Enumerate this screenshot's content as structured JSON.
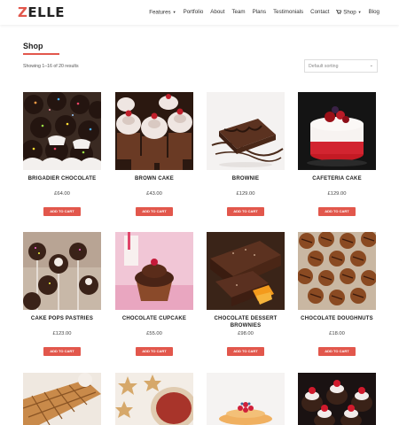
{
  "brand": {
    "name_rest": "ELLE",
    "name_first": "Z"
  },
  "nav": {
    "features": "Features",
    "portfolio": "Portfolio",
    "about": "About",
    "team": "Team",
    "plans": "Plans",
    "testimonials": "Testimonials",
    "contact": "Contact",
    "shop": "Shop",
    "blog": "Blog"
  },
  "page": {
    "title": "Shop",
    "results_text": "Showing 1–16 of 20 results",
    "sort_value": "Default sorting"
  },
  "colors": {
    "accent": "#e2574c"
  },
  "products": [
    {
      "name": "BRIGADIER CHOCOLATE",
      "price": "£64.00",
      "button": "ADD TO CART",
      "image": "brigadeiro-photo"
    },
    {
      "name": "BROWN CAKE",
      "price": "£43.00",
      "button": "ADD TO CART",
      "image": "cupcakes-photo"
    },
    {
      "name": "BROWNIE",
      "price": "£129.00",
      "button": "ADD TO CART",
      "image": "brownie-photo"
    },
    {
      "name": "CAFETERIA CAKE",
      "price": "£129.00",
      "button": "ADD TO CART",
      "image": "red-cake-photo"
    },
    {
      "name": "CAKE POPS PASTRIES",
      "price": "£123.00",
      "button": "ADD TO CART",
      "image": "cake-pops-photo"
    },
    {
      "name": "CHOCOLATE CUPCAKE",
      "price": "£55.00",
      "button": "ADD TO CART",
      "image": "cupcake-milk-photo"
    },
    {
      "name": "CHOCOLATE DESSERT BROWNIES",
      "price": "£98.00",
      "button": "ADD TO CART",
      "image": "dessert-brownies-photo"
    },
    {
      "name": "CHOCOLATE DOUGHNUTS",
      "price": "£18.00",
      "button": "ADD TO CART",
      "image": "doughnuts-photo"
    },
    {
      "name": "",
      "price": "",
      "button": "",
      "image": "waffles-photo"
    },
    {
      "name": "",
      "price": "",
      "button": "",
      "image": "star-cookies-photo"
    },
    {
      "name": "",
      "price": "",
      "button": "",
      "image": "pancakes-photo"
    },
    {
      "name": "",
      "price": "",
      "button": "",
      "image": "strawberry-cups-photo"
    }
  ]
}
